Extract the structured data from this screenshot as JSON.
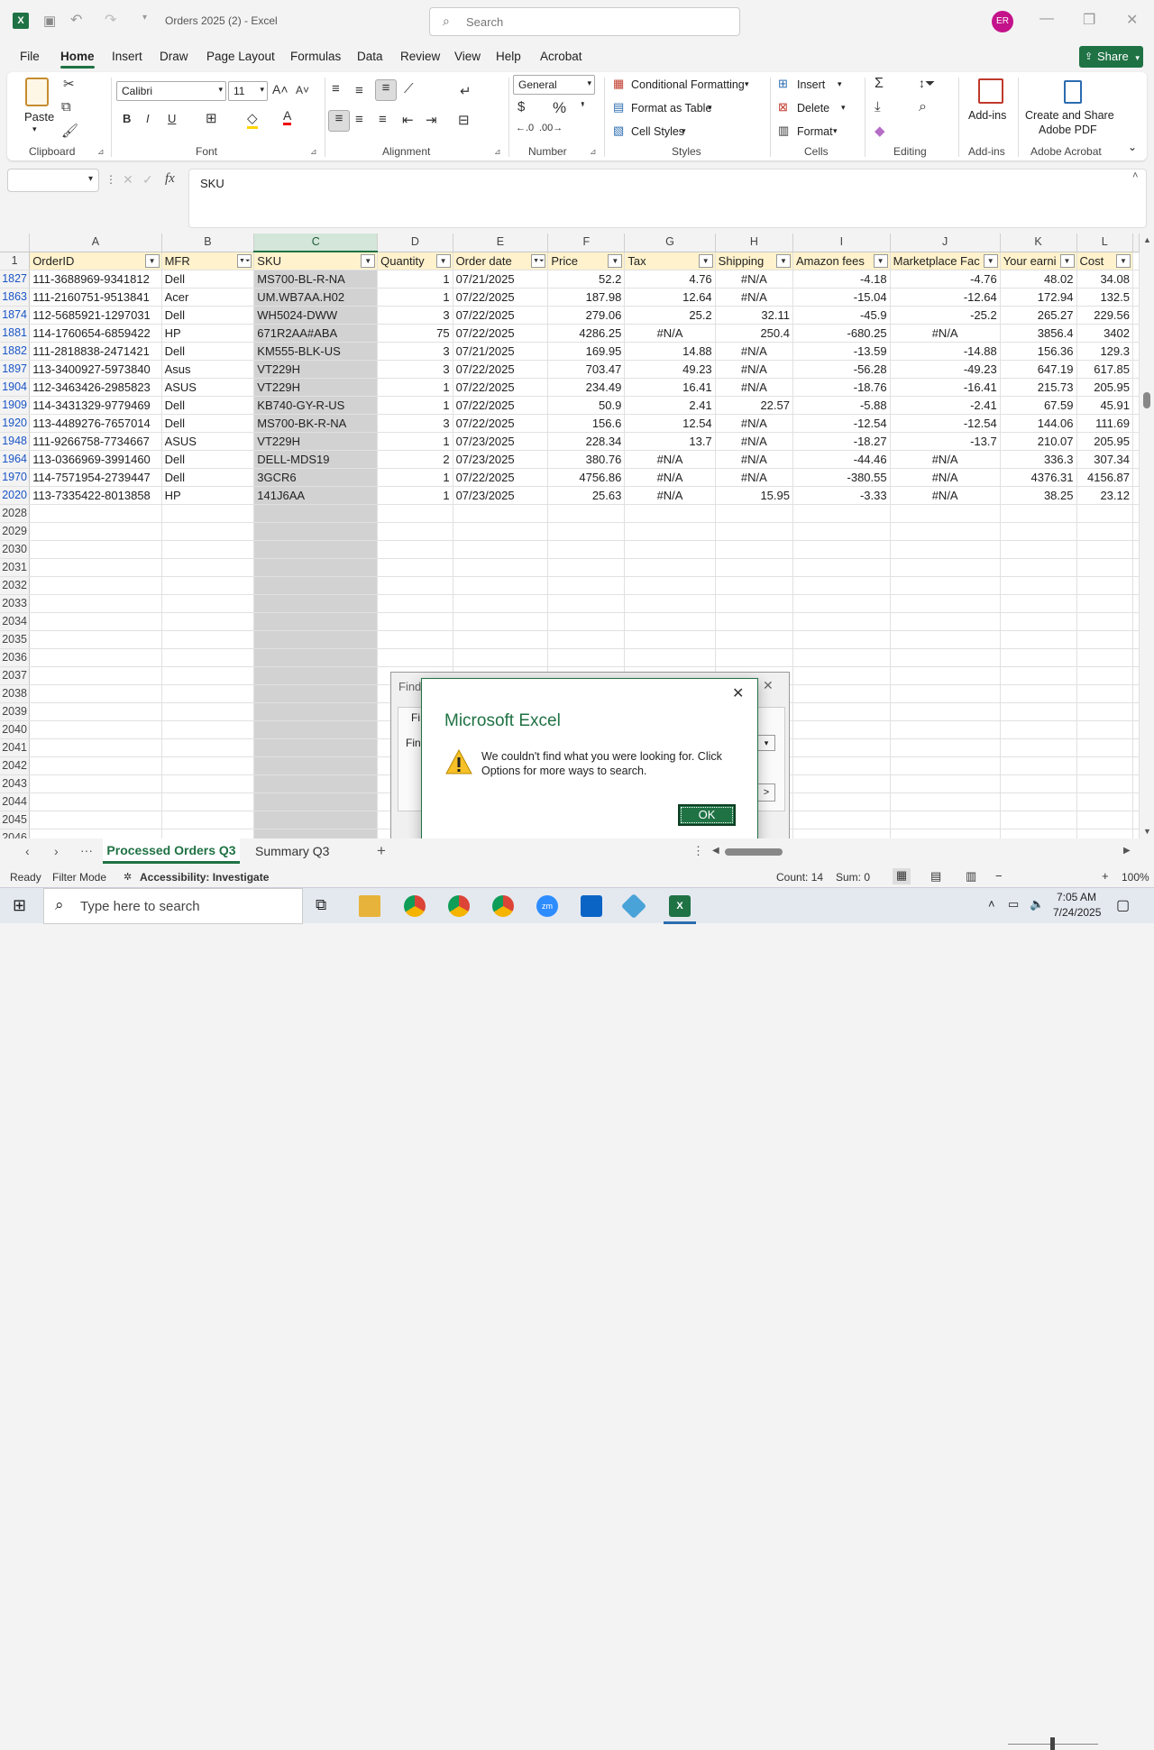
{
  "titlebar": {
    "doc_title": "Orders 2025 (2)  -  Excel",
    "search_placeholder": "Search",
    "avatar_initials": "ER"
  },
  "menu": [
    "File",
    "Home",
    "Insert",
    "Draw",
    "Page Layout",
    "Formulas",
    "Data",
    "Review",
    "View",
    "Help",
    "Acrobat"
  ],
  "share_label": "Share",
  "ribbon": {
    "paste": "Paste",
    "font_name": "Calibri",
    "font_size": "11",
    "number_format": "General",
    "cond_format": "Conditional Formatting",
    "format_table": "Format as Table",
    "cell_styles": "Cell Styles",
    "insert": "Insert",
    "delete": "Delete",
    "format": "Format",
    "addins": "Add-ins",
    "create_share_1": "Create and Share",
    "create_share_2": "Adobe PDF",
    "groups": {
      "clipboard": "Clipboard",
      "font": "Font",
      "alignment": "Alignment",
      "number": "Number",
      "styles": "Styles",
      "cells": "Cells",
      "editing": "Editing",
      "addins": "Add-ins",
      "adobe": "Adobe Acrobat"
    }
  },
  "formula_bar": {
    "name_box": "",
    "content": "SKU"
  },
  "columns": [
    "A",
    "B",
    "C",
    "D",
    "E",
    "F",
    "G",
    "H",
    "I",
    "J",
    "K",
    "L"
  ],
  "header_row": {
    "row": "1",
    "cells": [
      "OrderID",
      "MFR",
      "SKU",
      "Quantity",
      "Order date",
      "Price",
      "Tax",
      "Shipping",
      "Amazon fees",
      "Marketplace Fac",
      "Your earni",
      "Cost"
    ]
  },
  "rows": [
    {
      "r": "1827",
      "c": [
        "111-3688969-9341812",
        "Dell",
        "MS700-BL-R-NA",
        "1",
        "07/21/2025",
        "52.2",
        "4.76",
        "#N/A",
        "-4.18",
        "-4.76",
        "48.02",
        "34.08"
      ]
    },
    {
      "r": "1863",
      "c": [
        "111-2160751-9513841",
        "Acer",
        "UM.WB7AA.H02",
        "1",
        "07/22/2025",
        "187.98",
        "12.64",
        "#N/A",
        "-15.04",
        "-12.64",
        "172.94",
        "132.5"
      ]
    },
    {
      "r": "1874",
      "c": [
        "112-5685921-1297031",
        "Dell",
        "WH5024-DWW",
        "3",
        "07/22/2025",
        "279.06",
        "25.2",
        "32.11",
        "-45.9",
        "-25.2",
        "265.27",
        "229.56"
      ]
    },
    {
      "r": "1881",
      "c": [
        "114-1760654-6859422",
        "HP",
        "671R2AA#ABA",
        "75",
        "07/22/2025",
        "4286.25",
        "#N/A",
        "250.4",
        "-680.25",
        "#N/A",
        "3856.4",
        "3402"
      ]
    },
    {
      "r": "1882",
      "c": [
        "111-2818838-2471421",
        "Dell",
        "KM555-BLK-US",
        "3",
        "07/21/2025",
        "169.95",
        "14.88",
        "#N/A",
        "-13.59",
        "-14.88",
        "156.36",
        "129.3"
      ]
    },
    {
      "r": "1897",
      "c": [
        "113-3400927-5973840",
        "Asus",
        "VT229H",
        "3",
        "07/22/2025",
        "703.47",
        "49.23",
        "#N/A",
        "-56.28",
        "-49.23",
        "647.19",
        "617.85"
      ]
    },
    {
      "r": "1904",
      "c": [
        "112-3463426-2985823",
        "ASUS",
        "VT229H",
        "1",
        "07/22/2025",
        "234.49",
        "16.41",
        "#N/A",
        "-18.76",
        "-16.41",
        "215.73",
        "205.95"
      ]
    },
    {
      "r": "1909",
      "c": [
        "114-3431329-9779469",
        "Dell",
        "KB740-GY-R-US",
        "1",
        "07/22/2025",
        "50.9",
        "2.41",
        "22.57",
        "-5.88",
        "-2.41",
        "67.59",
        "45.91"
      ]
    },
    {
      "r": "1920",
      "c": [
        "113-4489276-7657014",
        "Dell",
        "MS700-BK-R-NA",
        "3",
        "07/22/2025",
        "156.6",
        "12.54",
        "#N/A",
        "-12.54",
        "-12.54",
        "144.06",
        "111.69"
      ]
    },
    {
      "r": "1948",
      "c": [
        "111-9266758-7734667",
        "ASUS",
        "VT229H",
        "1",
        "07/23/2025",
        "228.34",
        "13.7",
        "#N/A",
        "-18.27",
        "-13.7",
        "210.07",
        "205.95"
      ]
    },
    {
      "r": "1964",
      "c": [
        "113-0366969-3991460",
        "Dell",
        "DELL-MDS19",
        "2",
        "07/23/2025",
        "380.76",
        "#N/A",
        "#N/A",
        "-44.46",
        "#N/A",
        "336.3",
        "307.34"
      ]
    },
    {
      "r": "1970",
      "c": [
        "114-7571954-2739447",
        "Dell",
        "3GCR6",
        "1",
        "07/22/2025",
        "4756.86",
        "#N/A",
        "#N/A",
        "-380.55",
        "#N/A",
        "4376.31",
        "4156.87"
      ]
    },
    {
      "r": "2020",
      "c": [
        "113-7335422-8013858",
        "HP",
        "141J6AA",
        "1",
        "07/23/2025",
        "25.63",
        "#N/A",
        "15.95",
        "-3.33",
        "#N/A",
        "38.25",
        "23.12"
      ]
    }
  ],
  "empty_rows": [
    "2028",
    "2029",
    "2030",
    "2031",
    "2032",
    "2033",
    "2034",
    "2035",
    "2036",
    "2037",
    "2038",
    "2039",
    "2040",
    "2041",
    "2042",
    "2043",
    "2044",
    "2045",
    "2046"
  ],
  "sheet_tabs": {
    "active": "Processed Orders Q3",
    "other": "Summary Q3"
  },
  "status": {
    "ready": "Ready",
    "mode": "Filter Mode",
    "accessibility": "Accessibility: Investigate",
    "count": "Count: 14",
    "sum": "Sum: 0",
    "zoom": "100%"
  },
  "taskbar": {
    "search_placeholder": "Type here to search",
    "time": "7:05 AM",
    "date": "7/24/2025"
  },
  "find_dialog": {
    "title": "Find",
    "tab": "Fi",
    "label": "Fin"
  },
  "message_dialog": {
    "title": "Microsoft Excel",
    "text": "We couldn't find what you were looking for. Click Options for more ways to search.",
    "ok": "OK"
  }
}
